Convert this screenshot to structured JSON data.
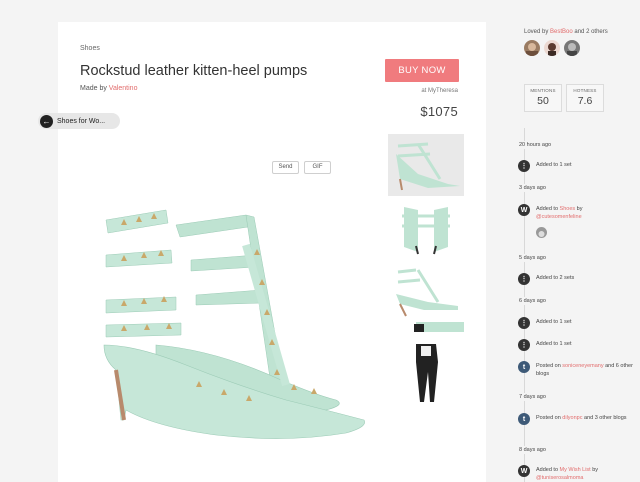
{
  "product": {
    "category": "Shoes",
    "title": "Rockstud leather kitten-heel pumps",
    "made_by_prefix": "Made by ",
    "brand": "Valentino",
    "buy_label": "BUY NOW",
    "store": "at MyTheresa",
    "price": "$1075"
  },
  "back_pill": {
    "label": "Shoes for Wo..."
  },
  "toolbar": {
    "send_label": "Send",
    "gif_label": "GIF"
  },
  "sidebar": {
    "loved_prefix": "Loved by ",
    "loved_user": "BestBoo",
    "loved_suffix": " and 2 others",
    "stats": [
      {
        "label": "MENTIONS",
        "value": "50"
      },
      {
        "label": "HOTNESS",
        "value": "7.6"
      }
    ],
    "timeline": [
      {
        "time": "20 hours ago",
        "events": [
          {
            "icon": "set-icon",
            "pre": "Added to 1 set",
            "user": "",
            "post": ""
          }
        ]
      },
      {
        "time": "3 days ago",
        "events": [
          {
            "icon": "wanelo-icon",
            "pre": "Added to ",
            "user": "Shoes",
            "post": " by",
            "user2": "@cutesomenfeline"
          }
        ]
      },
      {
        "time": "5 days ago",
        "events": [
          {
            "icon": "set-icon",
            "pre": "Added to 2 sets",
            "user": "",
            "post": ""
          }
        ]
      },
      {
        "time": "6 days ago",
        "events": [
          {
            "icon": "set-icon",
            "pre": "Added to 1 set",
            "user": "",
            "post": ""
          },
          {
            "icon": "set-icon",
            "pre": "Added to 1 set",
            "user": "",
            "post": ""
          }
        ]
      },
      {
        "time": "",
        "events": [
          {
            "icon": "tumblr-icon",
            "pre": "Posted on ",
            "user": "soniceneyemany",
            "post": " and 6 other blogs"
          }
        ]
      },
      {
        "time": "7 days ago",
        "events": [
          {
            "icon": "tumblr-icon",
            "pre": "Posted on ",
            "user": "dilyonpc",
            "post": " and 3 other blogs"
          }
        ]
      },
      {
        "time": "8 days ago",
        "events": [
          {
            "icon": "wanelo-icon",
            "pre": "Added to ",
            "user": "My Wish List",
            "post": " by",
            "user2": "@tuniserosalmoma"
          }
        ]
      }
    ]
  },
  "colors": {
    "accent": "#f07b7e",
    "link": "#e26d6d",
    "shoe": "#bfe3d2",
    "stud": "#c9a86a"
  }
}
